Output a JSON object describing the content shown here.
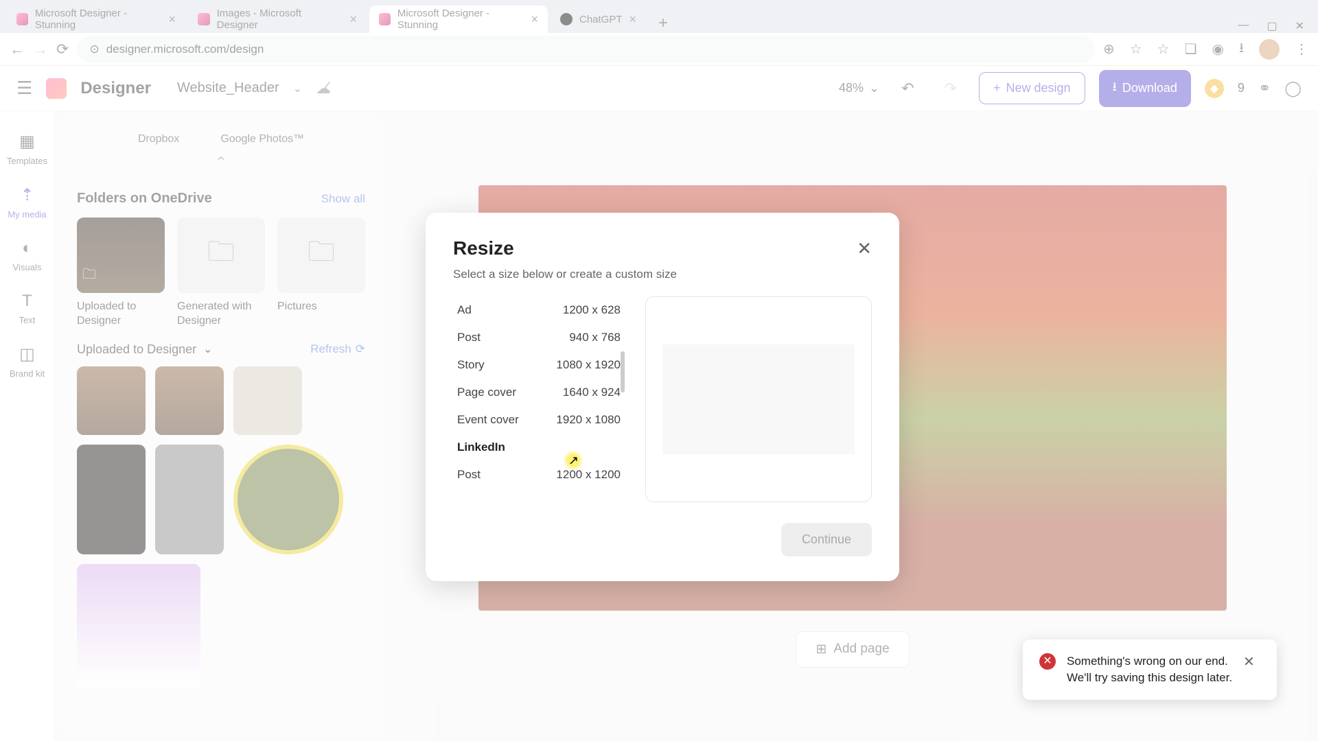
{
  "browser": {
    "tabs": [
      {
        "title": "Microsoft Designer - Stunning"
      },
      {
        "title": "Images - Microsoft Designer"
      },
      {
        "title": "Microsoft Designer - Stunning"
      },
      {
        "title": "ChatGPT"
      }
    ],
    "url": "designer.microsoft.com/design"
  },
  "header": {
    "brand": "Designer",
    "project": "Website_Header",
    "zoom": "48%",
    "new_design": "New design",
    "download": "Download",
    "credits": "9"
  },
  "rail": {
    "templates": "Templates",
    "my_media": "My media",
    "visuals": "Visuals",
    "text": "Text",
    "brand": "Brand kit"
  },
  "panel": {
    "dropbox": "Dropbox",
    "gphotos": "Google Photos™",
    "folders_title": "Folders on OneDrive",
    "show_all": "Show all",
    "folders": [
      {
        "label": "Uploaded to Designer"
      },
      {
        "label": "Generated with Designer"
      },
      {
        "label": "Pictures"
      }
    ],
    "uploaded_title": "Uploaded to Designer",
    "refresh": "Refresh"
  },
  "canvas": {
    "add_page": "Add page"
  },
  "modal": {
    "title": "Resize",
    "subtitle": "Select a size below or create a custom size",
    "sizes": [
      {
        "name": "Ad",
        "dim": "1200 x 628"
      },
      {
        "name": "Post",
        "dim": "940 x 768"
      },
      {
        "name": "Story",
        "dim": "1080 x 1920"
      },
      {
        "name": "Page cover",
        "dim": "1640 x 924"
      },
      {
        "name": "Event cover",
        "dim": "1920 x 1080"
      }
    ],
    "category": "LinkedIn",
    "sizes2": [
      {
        "name": "Post",
        "dim": "1200 x 1200"
      }
    ],
    "continue": "Continue"
  },
  "toast": {
    "line1": "Something's wrong on our end.",
    "line2": "We'll try saving this design later."
  }
}
